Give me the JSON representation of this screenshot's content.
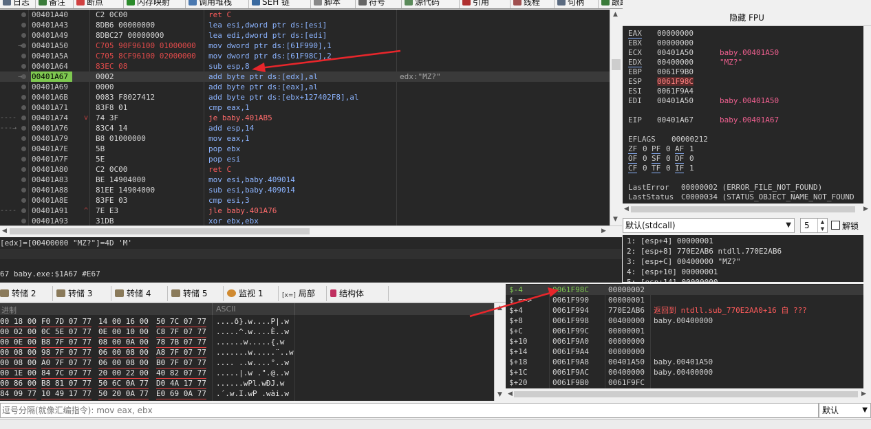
{
  "top_tabs": [
    {
      "label": "日志",
      "icon": "log-icon"
    },
    {
      "label": "备注",
      "icon": "note-icon"
    },
    {
      "label": "断点",
      "icon": "breakpoint-icon"
    },
    {
      "label": "内存映射",
      "icon": "memory-map-icon"
    },
    {
      "label": "调用堆栈",
      "icon": "call-stack-icon"
    },
    {
      "label": "SEH 链",
      "icon": "seh-chain-icon"
    },
    {
      "label": "脚本",
      "icon": "script-icon"
    },
    {
      "label": "符号",
      "icon": "symbol-icon"
    },
    {
      "label": "源代码",
      "icon": "source-icon"
    },
    {
      "label": "引用",
      "icon": "references-icon"
    },
    {
      "label": "线程",
      "icon": "threads-icon"
    },
    {
      "label": "句柄",
      "icon": "handles-icon"
    },
    {
      "label": "跟踪",
      "icon": "trace-icon"
    }
  ],
  "disasm": [
    {
      "addr": "00401A40",
      "bytes": "C2 0C00",
      "asm": "ret C",
      "type": "ret"
    },
    {
      "addr": "00401A43",
      "bytes": "8DB6 00000000",
      "asm": "lea esi,dword ptr ds:[esi]",
      "type": "mov"
    },
    {
      "addr": "00401A49",
      "bytes": "8DBC27 00000000",
      "asm": "lea edi,dword ptr ds:[edi]",
      "type": "mov"
    },
    {
      "addr": "00401A50",
      "bytes": "C705 90F96100 01000000",
      "asm": "mov dword ptr ds:[61F990],1",
      "type": "mov",
      "red_bytes": true,
      "gut": "→"
    },
    {
      "addr": "00401A5A",
      "bytes": "C705 8CF96100 02000000",
      "asm": "mov dword ptr ds:[61F98C],2",
      "type": "mov",
      "red_bytes": true
    },
    {
      "addr": "00401A64",
      "bytes": "83EC 08",
      "asm": "sub esp,8",
      "type": "mov",
      "red_bytes": true
    },
    {
      "addr": "00401A67",
      "bytes": "0002",
      "asm": "add byte ptr ds:[edx],al",
      "type": "mov",
      "current": true,
      "comment": "edx:\"MZ?\"",
      "gut": "→"
    },
    {
      "addr": "00401A69",
      "bytes": "0000",
      "asm": "add byte ptr ds:[eax],al",
      "type": "mov"
    },
    {
      "addr": "00401A6B",
      "bytes": "0083 F8027412",
      "asm": "add byte ptr ds:[ebx+127402F8],al",
      "type": "mov"
    },
    {
      "addr": "00401A71",
      "bytes": "83F8 01",
      "asm": "cmp eax,1",
      "type": "mov"
    },
    {
      "addr": "00401A74",
      "bytes": "74 3F",
      "asm": "je baby.401AB5",
      "type": "jmp",
      "jm": "v",
      "gut": "----"
    },
    {
      "addr": "00401A76",
      "bytes": "83C4 14",
      "asm": "add esp,14",
      "type": "mov",
      "gut": "---→"
    },
    {
      "addr": "00401A79",
      "bytes": "B8 01000000",
      "asm": "mov eax,1",
      "type": "mov"
    },
    {
      "addr": "00401A7E",
      "bytes": "5B",
      "asm": "pop ebx",
      "type": "mov"
    },
    {
      "addr": "00401A7F",
      "bytes": "5E",
      "asm": "pop esi",
      "type": "mov"
    },
    {
      "addr": "00401A80",
      "bytes": "C2 0C00",
      "asm": "ret C",
      "type": "ret"
    },
    {
      "addr": "00401A83",
      "bytes": "BE 14904000",
      "asm": "mov esi,baby.409014",
      "type": "mov"
    },
    {
      "addr": "00401A88",
      "bytes": "81EE 14904000",
      "asm": "sub esi,baby.409014",
      "type": "mov"
    },
    {
      "addr": "00401A8E",
      "bytes": "83FE 03",
      "asm": "cmp esi,3",
      "type": "mov"
    },
    {
      "addr": "00401A91",
      "bytes": "7E E3",
      "asm": "jle baby.401A76",
      "type": "jmp",
      "jm": "^",
      "gut": "----"
    },
    {
      "addr": "00401A93",
      "bytes": "31DB",
      "asm": "xor ebx,ebx",
      "type": "mov"
    }
  ],
  "info": {
    "line1": "[edx]=[00400000 \"MZ?\"]=4D 'M'",
    "line2": "67 baby.exe:$1A67 #E67"
  },
  "registers": {
    "header": "隐藏 FPU",
    "gp": [
      {
        "name": "EAX",
        "value": "00000000",
        "sym": ""
      },
      {
        "name": "EBX",
        "value": "00000000",
        "sym": ""
      },
      {
        "name": "ECX",
        "value": "00401A50",
        "sym": "baby.00401A50"
      },
      {
        "name": "EDX",
        "value": "00400000",
        "sym": "\"MZ?\""
      },
      {
        "name": "EBP",
        "value": "0061F9B0",
        "sym": ""
      },
      {
        "name": "ESP",
        "value": "0061F98C",
        "sym": ""
      },
      {
        "name": "ESI",
        "value": "0061F9A4",
        "sym": ""
      },
      {
        "name": "EDI",
        "value": "00401A50",
        "sym": "baby.00401A50"
      }
    ],
    "eip": {
      "name": "EIP",
      "value": "00401A67",
      "sym": "baby.00401A67"
    },
    "eflags": {
      "name": "EFLAGS",
      "value": "00000212"
    },
    "flags_rows": [
      [
        {
          "n": "ZF",
          "v": "0"
        },
        {
          "n": "PF",
          "v": "0"
        },
        {
          "n": "AF",
          "v": "1"
        }
      ],
      [
        {
          "n": "OF",
          "v": "0"
        },
        {
          "n": "SF",
          "v": "0"
        },
        {
          "n": "DF",
          "v": "0"
        }
      ],
      [
        {
          "n": "CF",
          "v": "0"
        },
        {
          "n": "TF",
          "v": "0"
        },
        {
          "n": "IF",
          "v": "1"
        }
      ]
    ],
    "last_error": {
      "name": "LastError",
      "value": "00000002 (ERROR_FILE_NOT_FOUND)"
    },
    "last_status": {
      "name": "LastStatus",
      "value": "C0000034 (STATUS_OBJECT_NAME_NOT_FOUND"
    }
  },
  "callconv": {
    "selected": "默认(stdcall)",
    "arg_count": "5",
    "lock_label": "解锁"
  },
  "stack_args": [
    "1: [esp+4] 00000001",
    "2: [esp+8] 770E2AB6 ntdll.770E2AB6",
    "3: [esp+C] 00400000 \"MZ?\"",
    "4: [esp+10] 00000001",
    "5: [esp+14] 00000000"
  ],
  "dump_tabs": [
    {
      "label": "转储 2",
      "kind": "dump"
    },
    {
      "label": "转储 3",
      "kind": "dump"
    },
    {
      "label": "转储 4",
      "kind": "dump"
    },
    {
      "label": "转储 5",
      "kind": "dump"
    },
    {
      "label": "监视 1",
      "kind": "watch"
    },
    {
      "label": "局部",
      "kind": "local",
      "icon_text": "[x=]"
    },
    {
      "label": "结构体",
      "kind": "struct"
    }
  ],
  "dump": {
    "col_hex": "进制",
    "col_ascii": "ASCII",
    "rows": [
      {
        "g": [
          "00 18 00",
          "F0 7D 07 77",
          "14 00 16 00",
          "50 7C 07 77"
        ],
        "ascii": "....ð}.w....P|.w"
      },
      {
        "g": [
          "00 02 00",
          "0C 5E 07 77",
          "0E 00 10 00",
          "C8 7F 07 77"
        ],
        "ascii": ".....^.w....È..w"
      },
      {
        "g": [
          "00 0E 00",
          "B8 7F 07 77",
          "08 00 0A 00",
          "78 7B 07 77"
        ],
        "ascii": "......w.....{.w"
      },
      {
        "g": [
          "00 08 00",
          "98 7F 07 77",
          "06 00 08 00",
          "A8 7F 07 77"
        ],
        "ascii": ".......w.....¨..w"
      },
      {
        "g": [
          "00 08 00",
          "A0 7F 07 77",
          "06 00 08 00",
          "B0 7F 07 77"
        ],
        "ascii": ".... ..w....°..w"
      },
      {
        "g": [
          "00 1E 00",
          "84 7C 07 77",
          "20 00 22 00",
          "40 82 07 77"
        ],
        "ascii": ".....|.w .\".@..w"
      },
      {
        "g": [
          "00 86 00",
          "B8 81 07 77",
          "50 6C 0A 77",
          "D0 4A 17 77"
        ],
        "ascii": "......wPl.wÐJ.w"
      },
      {
        "g": [
          "84 09 77",
          "10 49 17 77",
          "50 20 0A 77",
          "E0 69 0A 77"
        ],
        "ascii": ".´.w.I.wP .wài.w"
      }
    ]
  },
  "stack": [
    {
      "off": "$-4",
      "addr": "0061F98C",
      "val": "00000002",
      "cmt": "",
      "cur": true
    },
    {
      "off": "$ ==>",
      "addr": "0061F990",
      "val": "00000001",
      "cmt": ""
    },
    {
      "off": "$+4",
      "addr": "0061F994",
      "val": "770E2AB6",
      "cmt": "返回到 ntdll.sub_770E2AA0+16 自 ???",
      "red": true
    },
    {
      "off": "$+8",
      "addr": "0061F998",
      "val": "00400000",
      "cmt": "baby.00400000"
    },
    {
      "off": "$+C",
      "addr": "0061F99C",
      "val": "00000001",
      "cmt": ""
    },
    {
      "off": "$+10",
      "addr": "0061F9A0",
      "val": "00000000",
      "cmt": ""
    },
    {
      "off": "$+14",
      "addr": "0061F9A4",
      "val": "00000000",
      "cmt": ""
    },
    {
      "off": "$+18",
      "addr": "0061F9A8",
      "val": "00401A50",
      "cmt": "baby.00401A50"
    },
    {
      "off": "$+1C",
      "addr": "0061F9AC",
      "val": "00400000",
      "cmt": "baby.00400000"
    },
    {
      "off": "$+20",
      "addr": "0061F9B0",
      "val": "0061F9FC",
      "cmt": ""
    }
  ],
  "command": {
    "placeholder": "逗号分隔(就像汇编指令): mov eax, ebx",
    "mode": "默认"
  },
  "colors": {
    "eip_highlight": "#7ec850",
    "annotation_arrow": "#e8262b",
    "jump_red": "#ff5b5b"
  }
}
